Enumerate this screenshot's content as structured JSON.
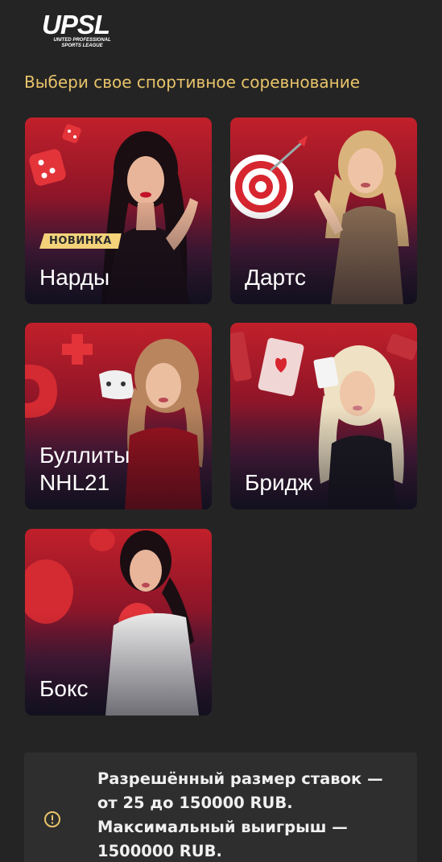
{
  "logo": {
    "main": "UPSL",
    "sub": "UNITED PROFESSIONAL SPORTS LEAGUE"
  },
  "heading": "Выбери свое спортивное соревнование",
  "cards": [
    {
      "title": "Нарды",
      "badge": "НОВИНКА"
    },
    {
      "title": "Дартс"
    },
    {
      "title": "Буллиты\nNHL21"
    },
    {
      "title": "Бридж"
    },
    {
      "title": "Бокс"
    }
  ],
  "notice": {
    "icon": "exclamation-circle-icon",
    "text": "Разрешённый размер ставок — от 25 до 150000 RUB. Максимальный выигрыш — 1500000 RUB.",
    "icon_color": "#e9c46a"
  },
  "colors": {
    "background": "#242424",
    "accent": "#e9c46a",
    "badge": "#f3d27a"
  }
}
